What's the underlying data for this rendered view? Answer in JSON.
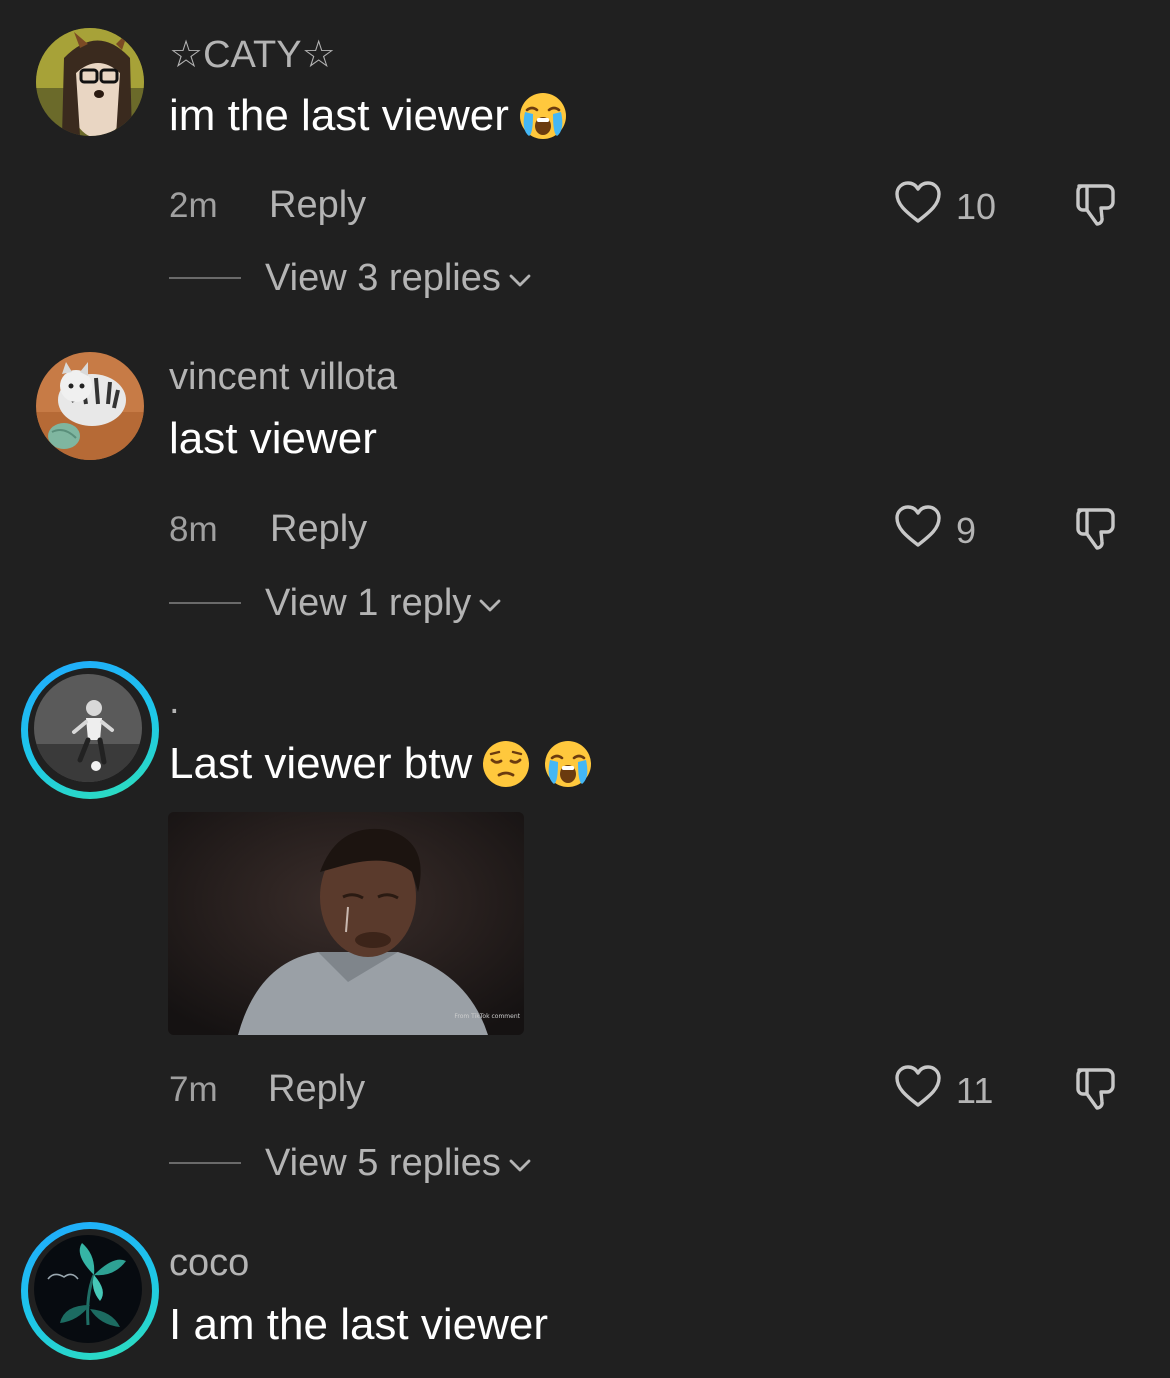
{
  "comments": [
    {
      "username": "☆CATY☆",
      "text": "im the last viewer",
      "emoji": [
        "loudly-crying-face"
      ],
      "time": "2m",
      "reply_label": "Reply",
      "likes": "10",
      "view_replies": "View 3 replies"
    },
    {
      "username": "vincent villota",
      "text": "last viewer",
      "time": "8m",
      "reply_label": "Reply",
      "likes": "9",
      "view_replies": "View 1 reply"
    },
    {
      "username": ".",
      "text": "Last viewer btw",
      "emoji": [
        "pensive-face",
        "loudly-crying-face"
      ],
      "time": "7m",
      "reply_label": "Reply",
      "likes": "11",
      "view_replies": "View 5 replies",
      "gif_watermark": "From TikTok comment"
    },
    {
      "username": "coco",
      "text": "I am the last viewer"
    }
  ],
  "colors": {
    "background": "#202020",
    "text_primary": "#ffffff",
    "text_secondary": "#b4b4b4",
    "story_ring_start": "#20a9ff",
    "story_ring_end": "#2fe0b8"
  },
  "icons": {
    "like": "heart-outline-icon",
    "dislike": "thumbs-down-outline-icon",
    "expand": "chevron-down-icon"
  }
}
